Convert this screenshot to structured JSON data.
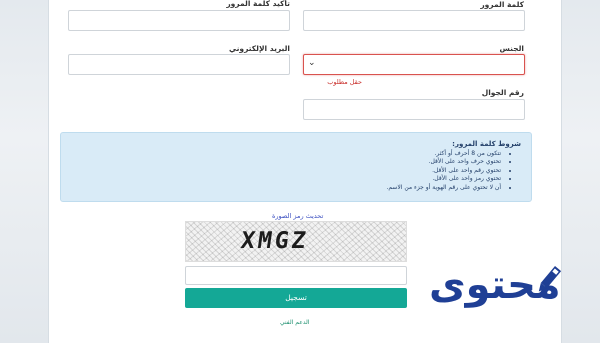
{
  "form": {
    "password_label": "كلمة المرور",
    "confirm_password_label": "تأكيد كلمة المرور",
    "gender_label": "الجنس",
    "email_label": "البريد الإلكتروني",
    "gender_error": "حقل مطلوب",
    "mobile_label": "رقم الجوال",
    "gender_value": ""
  },
  "rules": {
    "title": "شروط كلمة المرور:",
    "items": [
      "تتكون من 8 أحرف أو أكثر.",
      "تحتوي حرف واحد على الأقل.",
      "تحتوي رقم واحد على الأقل.",
      "تحتوي رمز واحد على الأقل.",
      "أن لا تحتوي على رقم الهوية أو جزء من الاسم."
    ]
  },
  "captcha": {
    "refresh_label": "تحديث رمز الصورة",
    "image_text": "XMGZ",
    "input_value": ""
  },
  "actions": {
    "submit_label": "تسجيل",
    "support_label": "الدعم الفني"
  },
  "watermark": {
    "logo_text": "محتوى",
    "brand_color": "#1f3f95"
  },
  "colors": {
    "accent": "#14a896",
    "error": "#d9534f",
    "info_bg": "#d9ebf7"
  }
}
